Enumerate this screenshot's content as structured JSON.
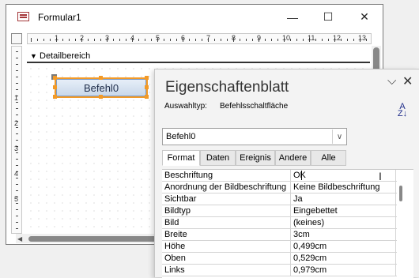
{
  "form_window": {
    "title": "Formular1",
    "controls": {
      "minimize": "—",
      "maximize": "☐",
      "close": "✕"
    },
    "section_label": "Detailbereich",
    "ruler_numbers_h": [
      "1",
      "2",
      "3",
      "4",
      "5",
      "6",
      "7",
      "8",
      "9",
      "10",
      "11",
      "12",
      "13"
    ],
    "ruler_numbers_v": [
      "1",
      "2",
      "3",
      "4",
      "5"
    ],
    "command_button_label": "Befehl0"
  },
  "property_sheet": {
    "title": "Eigenschaftenblatt",
    "collapse_glyph": "⌵",
    "close_glyph": "✕",
    "selection_type_label": "Auswahltyp:",
    "selection_type_value": "Befehlsschaltfläche",
    "sort_glyph": "A Z",
    "object_select_value": "Befehl0",
    "tabs": [
      "Format",
      "Daten",
      "Ereignis",
      "Andere",
      "Alle"
    ],
    "active_tab": "Format",
    "properties": [
      {
        "name": "Beschriftung",
        "value": "OK"
      },
      {
        "name": "Anordnung der Bildbeschriftung",
        "value": "Keine Bildbeschriftung"
      },
      {
        "name": "Sichtbar",
        "value": "Ja"
      },
      {
        "name": "Bildtyp",
        "value": "Eingebettet"
      },
      {
        "name": "Bild",
        "value": "(keines)"
      },
      {
        "name": "Breite",
        "value": "3cm"
      },
      {
        "name": "Höhe",
        "value": "0,499cm"
      },
      {
        "name": "Oben",
        "value": "0,529cm"
      },
      {
        "name": "Links",
        "value": "0,979cm"
      }
    ]
  },
  "colors": {
    "selection_handle": "#f29a28",
    "button_text": "#1f2d4a",
    "form_icon": "#a4373a"
  }
}
